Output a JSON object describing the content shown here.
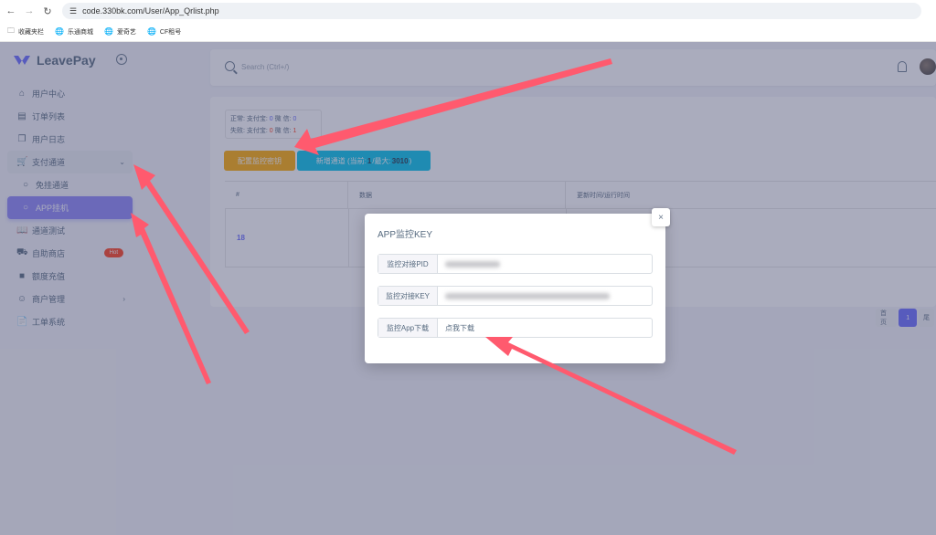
{
  "browser": {
    "url": "code.330bk.com/User/App_Qrlist.php",
    "bookmarks": [
      "收藏夹栏",
      "乐通商城",
      "爱奇艺",
      "CF租号"
    ]
  },
  "sidebar": {
    "brand": "LeavePay",
    "items": [
      {
        "label": "用户中心",
        "icon": "home-icon"
      },
      {
        "label": "订单列表",
        "icon": "list-icon"
      },
      {
        "label": "用户日志",
        "icon": "copy-icon"
      },
      {
        "label": "支付通道",
        "icon": "cart-icon"
      },
      {
        "label": "免挂通道",
        "icon": "circle-icon"
      },
      {
        "label": "APP挂机",
        "icon": "circle-icon"
      },
      {
        "label": "通道测试",
        "icon": "book-icon"
      },
      {
        "label": "自助商店",
        "icon": "truck-icon"
      },
      {
        "label": "额度充值",
        "icon": "money-icon"
      },
      {
        "label": "商户管理",
        "icon": "users-icon"
      },
      {
        "label": "工单系统",
        "icon": "file-icon"
      }
    ],
    "hot_badge": "Hot"
  },
  "topbar": {
    "search_placeholder": "Search (Ctrl+/)"
  },
  "stats": {
    "normal_label": "正常: 支付宝:",
    "normal_alipay": "0",
    "normal_wechat_label": "微 信:",
    "normal_wechat": "0",
    "fail_label": "失败: 支付宝:",
    "fail_alipay": "0",
    "fail_wechat_label": "微 信:",
    "fail_wechat": "1"
  },
  "buttons": {
    "config_key": "配置监控密钥",
    "new_channel_prefix": "新增通道 (当前:",
    "new_channel_current": "1",
    "new_channel_mid": "/最大:",
    "new_channel_max": "3010",
    "new_channel_suffix": ")"
  },
  "table": {
    "headers": [
      "#",
      "数据",
      "更新时间/运行时间"
    ],
    "rows": [
      {
        "id": "18"
      }
    ]
  },
  "pager": {
    "first": "首页",
    "current": "1",
    "last": "尾"
  },
  "modal": {
    "title": "APP监控KEY",
    "close": "×",
    "fields": [
      {
        "label": "监控对接PID",
        "value": ""
      },
      {
        "label": "监控对接KEY",
        "value": ""
      },
      {
        "label": "监控App下载",
        "value": "点我下载"
      }
    ]
  },
  "colors": {
    "primary": "#696cff",
    "warning": "#ffab00",
    "info": "#03c3ec",
    "danger": "#ff3e1d",
    "arrow": "#ff5a6e"
  }
}
